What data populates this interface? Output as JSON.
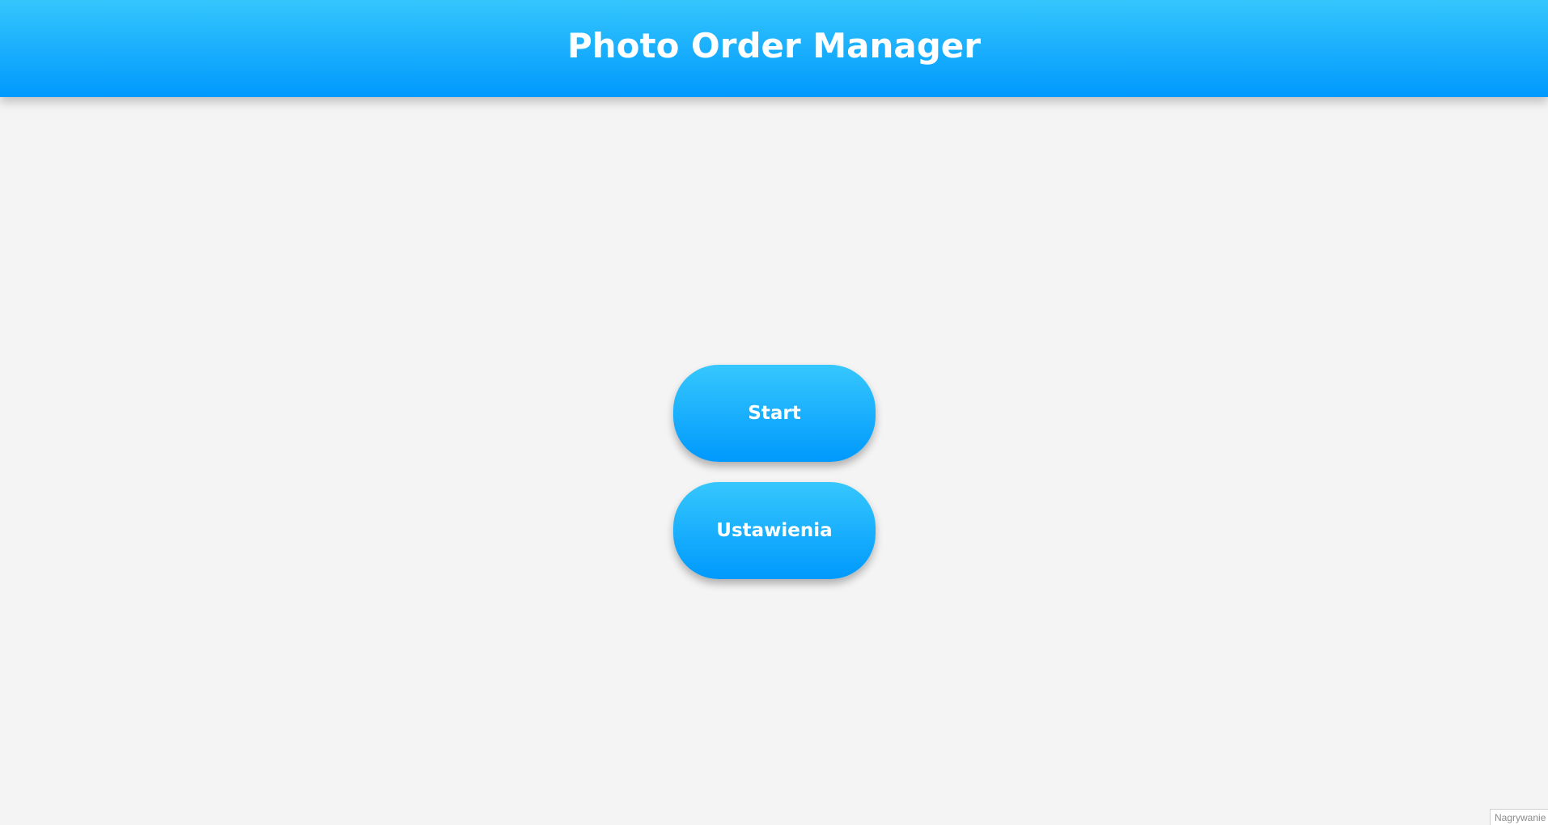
{
  "app": {
    "title": "Photo Order Manager"
  },
  "menu": {
    "start_label": "Start",
    "settings_label": "Ustawienia"
  },
  "recording_badge": {
    "text": "Nagrywanie"
  },
  "colors": {
    "header_gradient_top": "#35c6fd",
    "header_gradient_bottom": "#0099fd",
    "button_gradient_top": "#36c7fd",
    "button_gradient_bottom": "#0099fd",
    "background": "#f4f4f4",
    "text_on_accent": "#ffffff"
  }
}
